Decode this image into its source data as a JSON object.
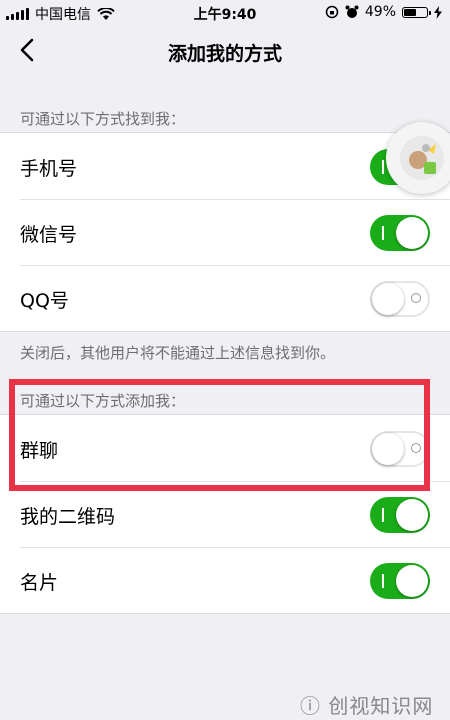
{
  "status_bar": {
    "carrier": "中国电信",
    "time": "上午9:40",
    "battery": "49%",
    "battery_level": 0.49
  },
  "nav": {
    "title": "添加我的方式"
  },
  "find_section": {
    "header": "可通过以下方式找到我：",
    "items": [
      {
        "label": "手机号",
        "enabled": true
      },
      {
        "label": "微信号",
        "enabled": true
      },
      {
        "label": "QQ号",
        "enabled": false
      }
    ],
    "footer": "关闭后，其他用户将不能通过上述信息找到你。"
  },
  "add_section": {
    "header": "可通过以下方式添加我：",
    "items": [
      {
        "label": "群聊",
        "enabled": false
      },
      {
        "label": "我的二维码",
        "enabled": true
      },
      {
        "label": "名片",
        "enabled": true
      }
    ]
  },
  "colors": {
    "toggle_on": "#1aad19",
    "highlight": "#ea3247",
    "background": "#efeff4"
  },
  "watermark": "ⓘ 创视知识网"
}
